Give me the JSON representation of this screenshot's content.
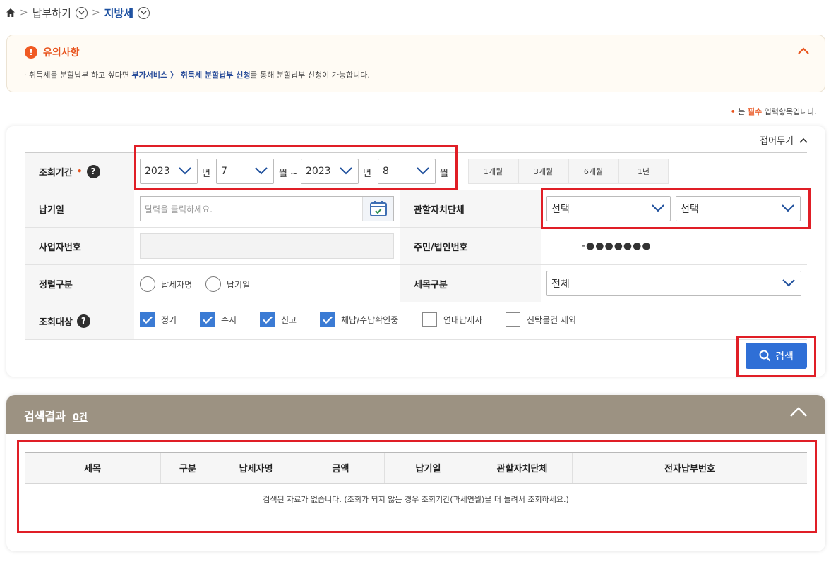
{
  "breadcrumb": {
    "items": [
      "납부하기",
      "지방세"
    ]
  },
  "notice": {
    "title": "유의사항",
    "text_prefix": "· 취득세를 분할납부 하고 싶다면 ",
    "link_text": "부가서비스 〉 취득세 분할납부 신청",
    "text_suffix": "를 통해 분할납부 신청이 가능합니다."
  },
  "required_note": {
    "dot": "•",
    "prefix": " 는 ",
    "word": "필수",
    "suffix": " 입력항목입니다."
  },
  "panel": {
    "fold_label": "접어두기",
    "period": {
      "label": "조회기간",
      "required_dot": "•",
      "start_year": "2023",
      "start_month": "7",
      "end_year": "2023",
      "end_month": "8",
      "unit_year": "년",
      "unit_month_tilde": "월 ~",
      "unit_month": "월",
      "quick_buttons": [
        "1개월",
        "3개월",
        "6개월",
        "1년"
      ]
    },
    "pay_date": {
      "label": "납기일",
      "placeholder": "달력을 클릭하세요."
    },
    "jurisdiction": {
      "label": "관할자치단체",
      "select1": "선택",
      "select2": "선택"
    },
    "business_no": {
      "label": "사업자번호",
      "value": ""
    },
    "resident_no": {
      "label": "주민/법인번호",
      "value": "-●●●●●●●"
    },
    "sort": {
      "label": "정렬구분",
      "options": [
        "납세자명",
        "납기일"
      ]
    },
    "tax_item": {
      "label": "세목구분",
      "value": "전체"
    },
    "target": {
      "label": "조회대상",
      "options": [
        {
          "label": "정기",
          "checked": true
        },
        {
          "label": "수시",
          "checked": true
        },
        {
          "label": "신고",
          "checked": true
        },
        {
          "label": "체납/수납확인중",
          "checked": true
        },
        {
          "label": "연대납세자",
          "checked": false
        },
        {
          "label": "신탁물건 제외",
          "checked": false
        }
      ]
    },
    "search_button": "검색"
  },
  "results": {
    "title": "검색결과",
    "count": "0건",
    "columns": [
      "세목",
      "구분",
      "납세자명",
      "금액",
      "납기일",
      "관할자치단체",
      "전자납부번호"
    ],
    "empty_message": "검색된 자료가 없습니다. (조회가 되지 않는 경우 조회기간(과세연월)을 더 늘려서 조회하세요.)"
  },
  "colors": {
    "accent_orange": "#e8541e",
    "primary_blue": "#2f6fd6",
    "results_header": "#9c9282",
    "highlight_red": "#e01e26"
  }
}
